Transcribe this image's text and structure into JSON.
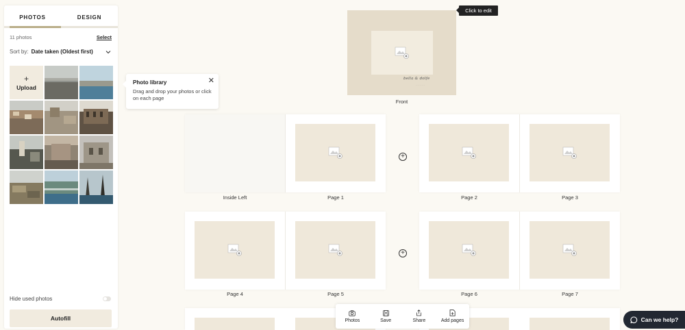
{
  "sidebar": {
    "tabs": [
      {
        "label": "PHOTOS"
      },
      {
        "label": "DESIGN"
      }
    ],
    "photo_count": "11 photos",
    "select_label": "Select",
    "sort_label": "Sort by:",
    "sort_value": "Date taken (Oldest first)",
    "upload_label": "Upload",
    "upload_plus": "+",
    "hide_used_label": "Hide used photos",
    "autofill_label": "Autofill"
  },
  "tooltip": {
    "title": "Photo library",
    "body": "Drag and drop your photos or click on each page",
    "close": "✕"
  },
  "cover": {
    "label": "Front",
    "click_to_edit": "Click to edit"
  },
  "pages": {
    "inside_left": "Inside Left",
    "p1": "Page 1",
    "p2": "Page 2",
    "p3": "Page 3",
    "p4": "Page 4",
    "p5": "Page 5",
    "p6": "Page 6",
    "p7": "Page 7"
  },
  "toolbar": {
    "photos": "Photos",
    "save": "Save",
    "share": "Share",
    "add_pages": "Add pages"
  },
  "help": {
    "label": "Can we help?"
  },
  "colors": {
    "accent": "#b9ad88",
    "slot": "#efe8da",
    "background": "#fbf9f3",
    "help_bg": "#222832"
  }
}
